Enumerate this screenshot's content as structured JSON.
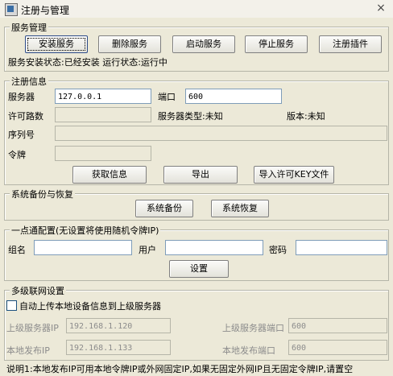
{
  "window": {
    "title": "注册与管理",
    "close_glyph": "×"
  },
  "service": {
    "legend": "服务管理",
    "buttons": [
      "安装服务",
      "删除服务",
      "启动服务",
      "停止服务",
      "注册插件"
    ],
    "status": "服务安装状态:已经安装  运行状态:运行中"
  },
  "register": {
    "legend": "注册信息",
    "server_label": "服务器",
    "server_value": "127.0.0.1",
    "port_label": "端口",
    "port_value": "600",
    "license_count_label": "许可路数",
    "server_type_label": "服务器类型:未知",
    "version_label": "版本:未知",
    "serial_label": "序列号",
    "token_label": "令牌",
    "buttons": [
      "获取信息",
      "导出",
      "导入许可KEY文件"
    ]
  },
  "backup": {
    "legend": "系统备份与恢复",
    "buttons": [
      "系统备份",
      "系统恢复"
    ]
  },
  "oneclick": {
    "legend": "一点通配置(无设置将使用随机令牌IP)",
    "group_label": "组名",
    "user_label": "用户",
    "password_label": "密码",
    "setup_button": "设置"
  },
  "network": {
    "legend": "多级联网设置",
    "auto_upload_label": "自动上传本地设备信息到上级服务器",
    "auto_upload_checked": false,
    "upper_ip_label": "上级服务器IP",
    "upper_ip_value": "192.168.1.120",
    "upper_port_label": "上级服务器端口",
    "upper_port_value": "600",
    "local_ip_label": "本地发布IP",
    "local_ip_value": "192.168.1.133",
    "local_port_label": "本地发布端口",
    "local_port_value": "600"
  },
  "footer": "说明1:本地发布IP可用本地令牌IP或外网固定IP,如果无固定外网IP且无固定令牌IP,请置空"
}
